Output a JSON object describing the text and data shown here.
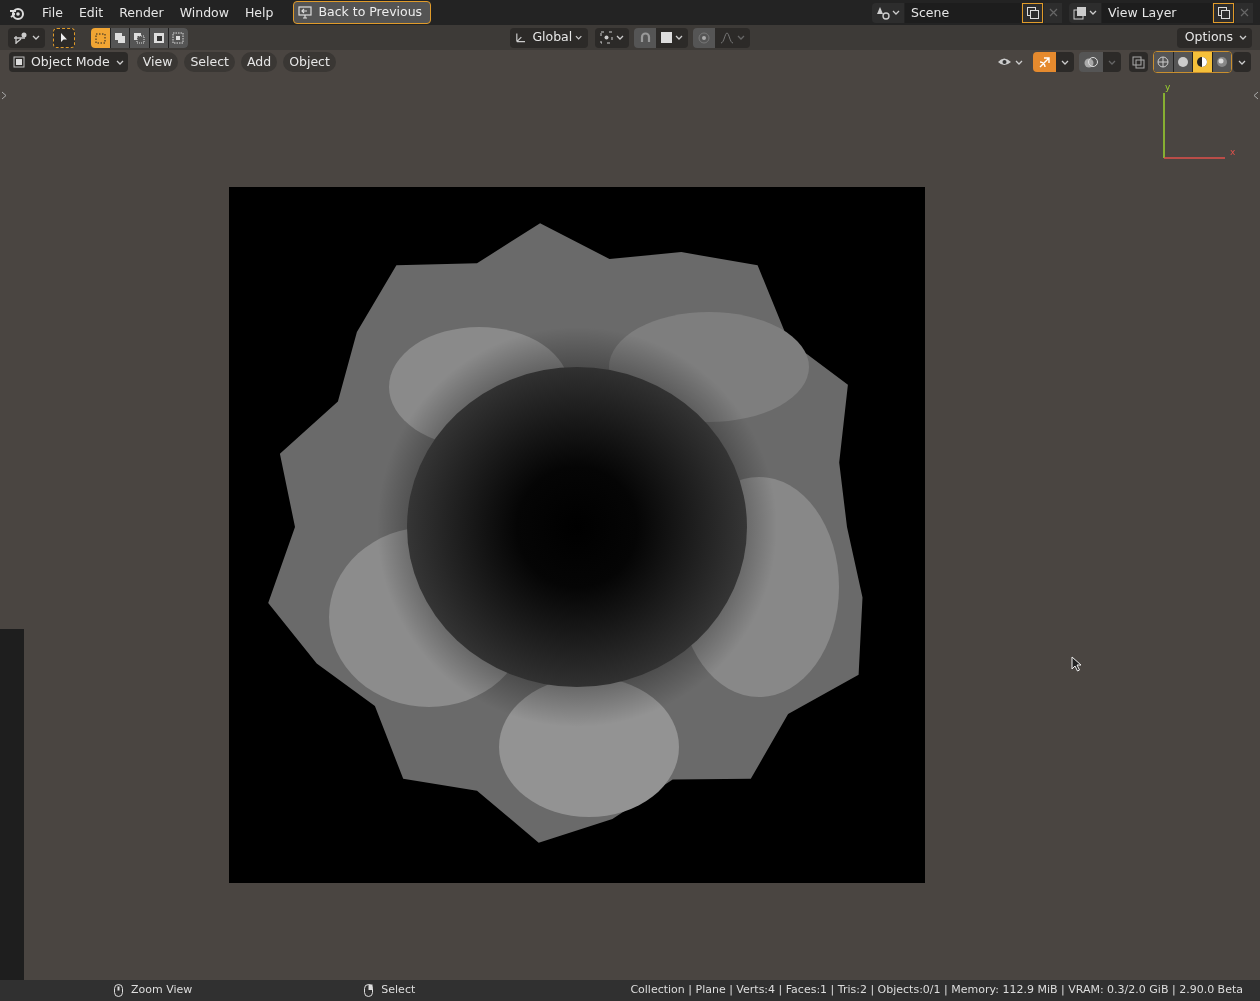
{
  "topbar": {
    "menus": [
      "File",
      "Edit",
      "Render",
      "Window",
      "Help"
    ],
    "back_button": "Back to Previous",
    "scene": "Scene",
    "view_layer": "View Layer"
  },
  "tool_header": {
    "select_modes": [
      {
        "selected": true
      },
      {
        "selected": false
      },
      {
        "selected": false
      },
      {
        "selected": false
      },
      {
        "selected": false
      }
    ],
    "orientation": "Global",
    "options": "Options"
  },
  "viewport_header": {
    "mode": "Object Mode",
    "menus": [
      "View",
      "Select",
      "Add",
      "Object"
    ],
    "gizmos": {
      "on": true
    },
    "xray": {
      "on": false
    },
    "shading_modes": [
      {
        "selected": false
      },
      {
        "selected": false
      },
      {
        "selected": true
      },
      {
        "selected": false
      }
    ]
  },
  "viewport": {
    "axes": {
      "y": "y",
      "x": "x"
    }
  },
  "status_bar": {
    "hints": [
      {
        "kind": "middle-mouse",
        "label": "Zoom View"
      },
      {
        "kind": "left-mouse",
        "label": "Select"
      }
    ],
    "stats": "Collection | Plane | Verts:4 | Faces:1 | Tris:2 | Objects:0/1 | Memory: 112.9 MiB | VRAM: 0.3/2.0 GiB | 2.90.0 Beta"
  }
}
